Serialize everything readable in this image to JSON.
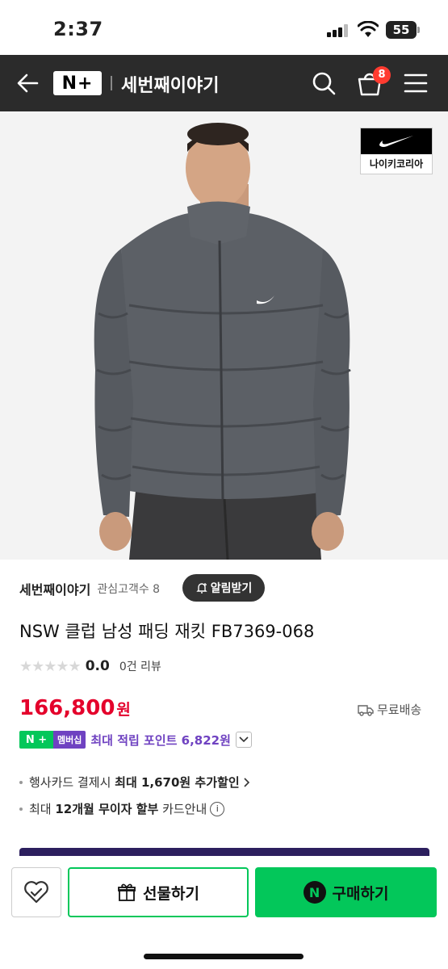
{
  "status_bar": {
    "time": "2:37",
    "battery": "55"
  },
  "nav": {
    "logo_text": "N+",
    "store_name": "세번째이야기",
    "cart_count": "8",
    "icons": [
      "back-arrow-icon",
      "search-icon",
      "cart-icon",
      "hamburger-menu-icon"
    ]
  },
  "brand_badge": {
    "label": "나이키코리아"
  },
  "seller": {
    "name": "세번째이야기",
    "followers": "관심고객수 8",
    "alarm_label": "알림받기"
  },
  "product": {
    "title": "NSW 클럽 남성 패딩 재킷 FB7369-068",
    "stars": "★★★★★",
    "rating": "0.0",
    "reviews": "0건 리뷰",
    "price": "166,800",
    "price_unit": "원",
    "shipping": "무료배송"
  },
  "membership": {
    "badge_n": "N +",
    "badge_label": "멤버십",
    "points_text": "최대 적립 포인트 6,822원"
  },
  "benefits": {
    "card_prefix": "행사카드 결제시 ",
    "card_bold": "최대 1,670원 추가할인",
    "installment_prefix": "최대 ",
    "installment_bold": "12개월 무이자 할부",
    "installment_suffix": " 카드안내",
    "info_glyph": "i"
  },
  "bottom_bar": {
    "gift_label": "선물하기",
    "buy_label": "구매하기",
    "npay_glyph": "N"
  },
  "colors": {
    "naver_green": "#03c75a",
    "price_red": "#e4002b",
    "membership_purple": "#6f42c1",
    "nav_dark": "#2b2b2b"
  }
}
